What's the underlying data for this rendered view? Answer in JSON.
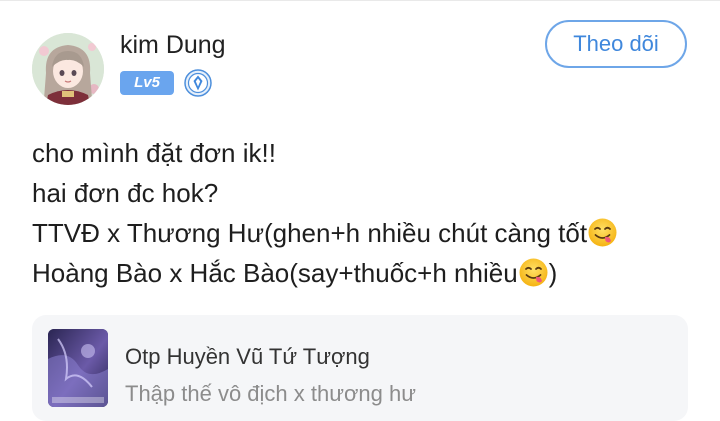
{
  "user": {
    "name": "kim Dung",
    "level": "Lv5",
    "avatar": "anime-girl-avatar",
    "badge_icon": "shield-icon"
  },
  "follow": {
    "label": "Theo dõi"
  },
  "post": {
    "lines": [
      {
        "text": "cho mình đặt đơn ik!!",
        "trailing": ""
      },
      {
        "text": "hai đơn đc hok?",
        "trailing": ""
      },
      {
        "text": "TTVĐ x Thương Hư(ghen+h nhiều chút càng tốt",
        "emoji": "yum-emoji",
        "trailing": ""
      },
      {
        "text": "Hoàng Bào x Hắc Bào(say+thuốc+h nhiều",
        "emoji": "yum-emoji",
        "trailing": ")"
      }
    ]
  },
  "linked_card": {
    "title": "Otp Huyền Vũ Tứ Tượng",
    "subtitle": "Thập thế vô địch x thương hư",
    "thumbnail": "cover-art-thumbnail"
  },
  "colors": {
    "accent": "#3f87dc",
    "follow_border": "#6ea6e8",
    "level_badge": "#6aa5ee",
    "card_background": "#f5f6f8",
    "emoji_face": "#ffcc33"
  }
}
